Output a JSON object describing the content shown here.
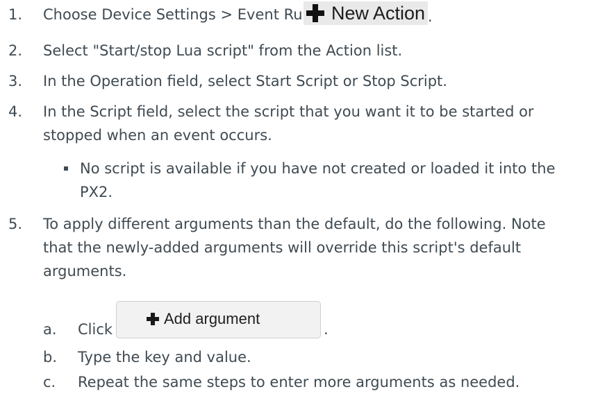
{
  "steps": [
    {
      "num": "1.",
      "text": "Choose Device Settings > Event Rules >",
      "suffix": "."
    },
    {
      "num": "2.",
      "text": "Select \"Start/stop Lua script\" from the Action list."
    },
    {
      "num": "3.",
      "text": "In the Operation field, select Start Script or Stop Script."
    },
    {
      "num": "4.",
      "lines": [
        "In the Script field, select the script that you want it to be started or",
        "stopped when an event occurs."
      ]
    },
    {
      "num": "5.",
      "lines": [
        "To apply different arguments than the default, do the following. Note",
        "that the newly-added arguments will override this script's default",
        "arguments."
      ]
    }
  ],
  "bullet": {
    "lines": [
      "No script is available if you have not created or loaded it into the",
      "PX2."
    ]
  },
  "new_action_button": {
    "label": "New Action",
    "icon": "plus-icon"
  },
  "substeps": [
    {
      "letter": "a.",
      "text": "Click",
      "suffix": "."
    },
    {
      "letter": "b.",
      "text": "Type the key and value."
    },
    {
      "letter": "c.",
      "text": "Repeat the same steps to enter more arguments as needed."
    }
  ],
  "add_argument_button": {
    "label": "Add argument",
    "icon": "plus-icon"
  }
}
